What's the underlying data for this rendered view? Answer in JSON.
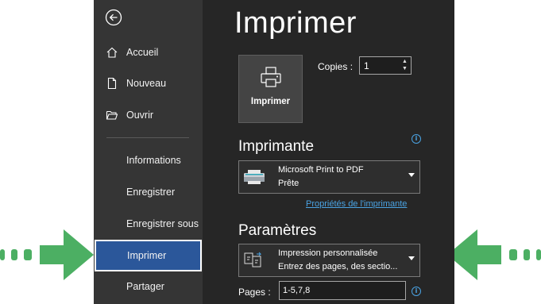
{
  "sidebar": {
    "items": [
      {
        "label": "Accueil",
        "icon": "home-icon"
      },
      {
        "label": "Nouveau",
        "icon": "new-document-icon"
      },
      {
        "label": "Ouvrir",
        "icon": "open-folder-icon"
      },
      {
        "label": "Informations"
      },
      {
        "label": "Enregistrer"
      },
      {
        "label": "Enregistrer sous"
      },
      {
        "label": "Imprimer",
        "active": true
      },
      {
        "label": "Partager"
      }
    ]
  },
  "main": {
    "title": "Imprimer",
    "print_button_label": "Imprimer",
    "copies_label": "Copies :",
    "copies_value": "1",
    "printer_section_title": "Imprimante",
    "printer": {
      "name": "Microsoft Print to PDF",
      "status": "Prête"
    },
    "printer_properties_link": "Propriétés de l'imprimante",
    "settings_section_title": "Paramètres",
    "print_range": {
      "name": "Impression personnalisée",
      "description": "Entrez des pages, des sectio..."
    },
    "pages_label": "Pages :",
    "pages_value": "1-5,7,8"
  },
  "colors": {
    "accent": "#2b579a",
    "arrow": "#4caf63",
    "link": "#4aa3e3",
    "background": "#262626",
    "sidebar": "#353535"
  }
}
